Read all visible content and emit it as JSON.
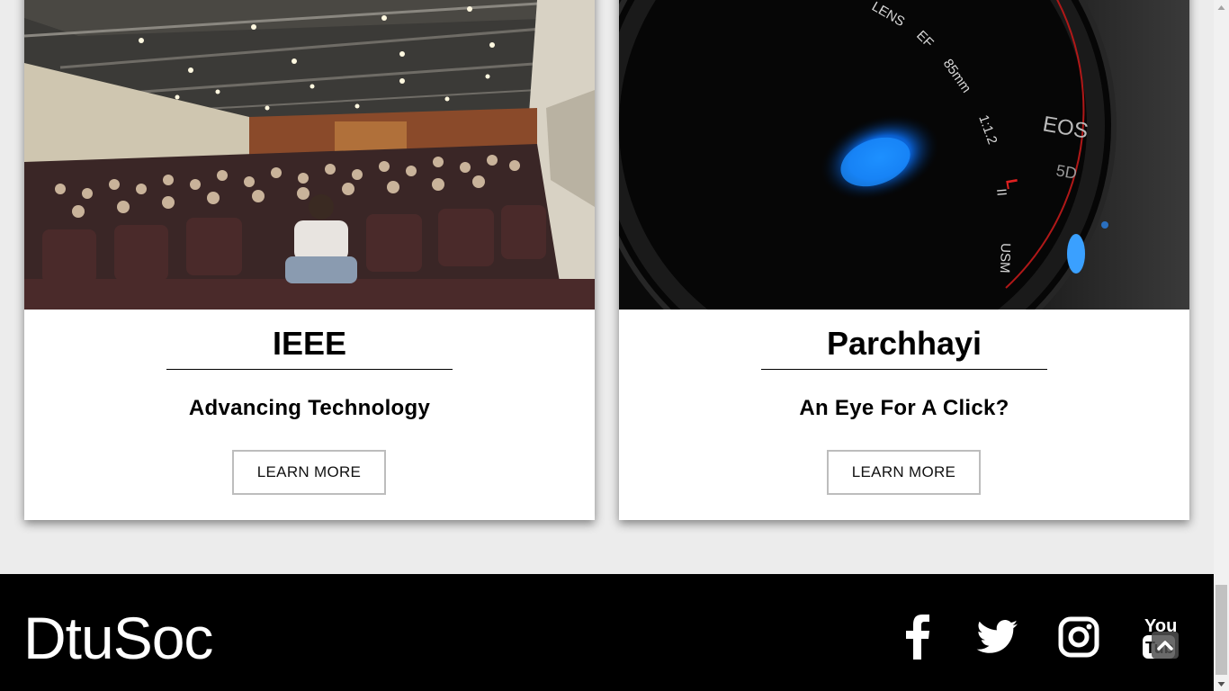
{
  "cards": [
    {
      "title": "IEEE",
      "tagline": "Advancing Technology",
      "button": "LEARN MORE",
      "image_icon": "auditorium-photo"
    },
    {
      "title": "Parchhayi",
      "tagline": "An Eye For A Click?",
      "button": "LEARN MORE",
      "image_icon": "camera-lens-photo"
    }
  ],
  "footer": {
    "brand": "DtuSoc",
    "social": [
      "facebook-icon",
      "twitter-icon",
      "instagram-icon",
      "youtube-icon"
    ]
  },
  "colors": {
    "footer_bg": "#000000",
    "page_bg": "#ececec",
    "card_bg": "#ffffff"
  }
}
